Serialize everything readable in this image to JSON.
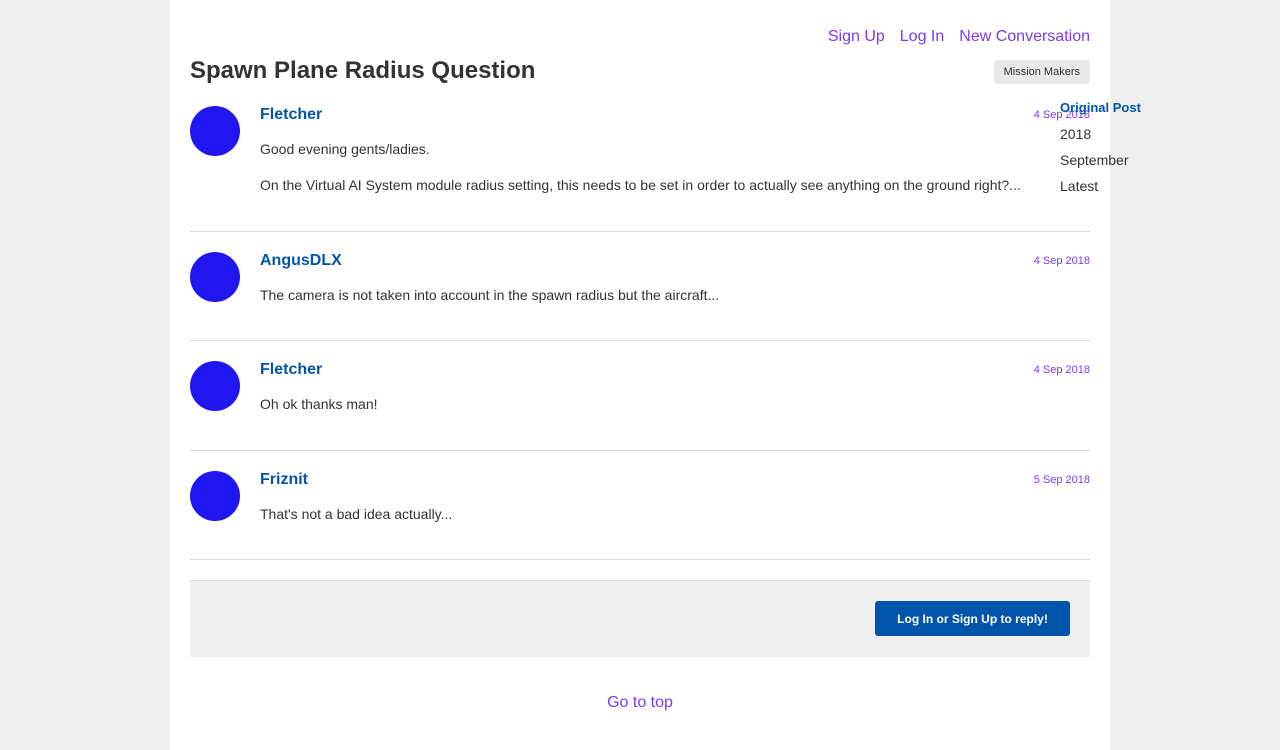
{
  "nav": {
    "sign_up": "Sign Up",
    "log_in": "Log In",
    "new_conversation": "New Conversation"
  },
  "discussion": {
    "title": "Spawn Plane Radius Question",
    "tag": "Mission Makers"
  },
  "scrubber": {
    "original_post": "Original Post",
    "year": "2018",
    "month": "September",
    "latest": "Latest"
  },
  "posts": [
    {
      "author": "Fletcher",
      "date": "4 Sep 2018",
      "paragraphs": [
        "Good evening gents/ladies.",
        "On the Virtual AI System module radius setting, this needs to be set in order to actually see anything on the ground right?..."
      ]
    },
    {
      "author": "AngusDLX",
      "date": "4 Sep 2018",
      "paragraphs": [
        "The camera is not taken into account in the spawn radius but the aircraft..."
      ]
    },
    {
      "author": "Fletcher",
      "date": "4 Sep 2018",
      "paragraphs": [
        "Oh ok thanks man!"
      ]
    },
    {
      "author": "Friznit",
      "date": "5 Sep 2018",
      "paragraphs": [
        "That's not a bad idea actually..."
      ]
    }
  ],
  "reply": {
    "button": "Log In or Sign Up to reply!"
  },
  "footer": {
    "go_to_top": "Go to top"
  },
  "colors": {
    "accent": "#7c3aed",
    "link": "#0055aa",
    "avatar": "#1f16f0"
  }
}
